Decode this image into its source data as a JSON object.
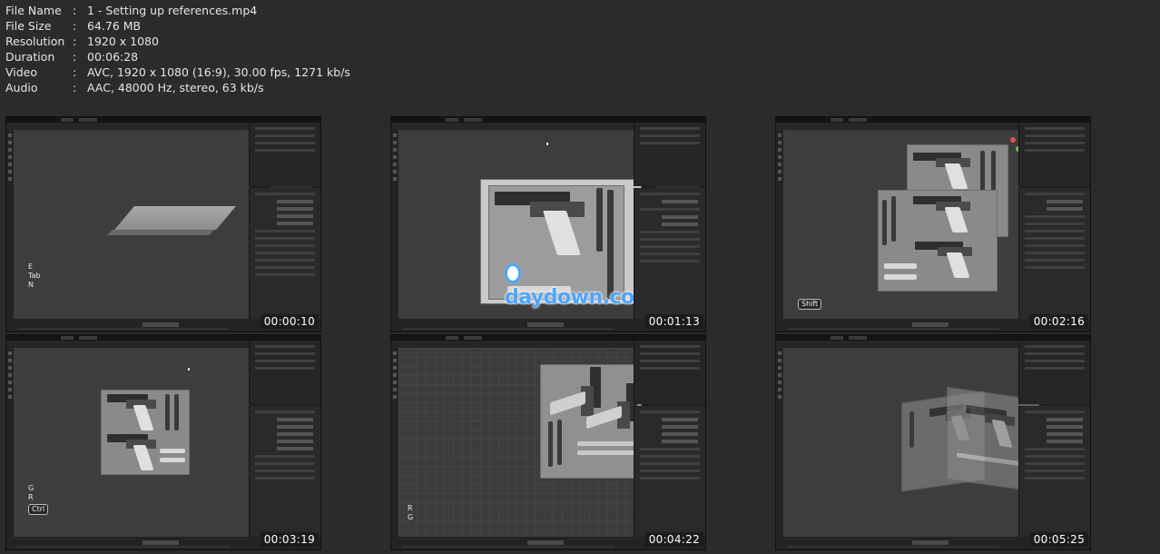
{
  "info": {
    "rows": [
      {
        "label": "File Name",
        "value": "1 - Setting up references.mp4"
      },
      {
        "label": "File Size",
        "value": "64.76 MB"
      },
      {
        "label": "Resolution",
        "value": "1920 x 1080"
      },
      {
        "label": "Duration",
        "value": "00:06:28"
      },
      {
        "label": "Video",
        "value": "AVC, 1920 x 1080 (16:9), 30.00 fps, 1271 kb/s"
      },
      {
        "label": "Audio",
        "value": "AAC, 48000 Hz, stereo, 63 kb/s"
      }
    ],
    "separator": ":"
  },
  "thumbnails": [
    {
      "timestamp": "00:00:10",
      "keys": [
        "E",
        "Tab",
        "N"
      ]
    },
    {
      "timestamp": "00:01:13",
      "watermark": "daydown.com"
    },
    {
      "timestamp": "00:02:16",
      "key_badge": "Shift"
    },
    {
      "timestamp": "00:03:19",
      "keys": [
        "G",
        "R"
      ],
      "key_badge": "Ctrl"
    },
    {
      "timestamp": "00:04:22",
      "keys": [
        "R",
        "G"
      ]
    },
    {
      "timestamp": "00:05:25"
    }
  ],
  "colors": {
    "background": "#2b2b2b",
    "watermark": "#4ea6ff",
    "gizmo_x": "#e0504a",
    "gizmo_y": "#7ac043",
    "gizmo_z": "#4a8fe0"
  }
}
